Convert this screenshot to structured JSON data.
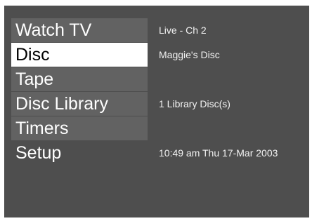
{
  "menu": {
    "items": [
      {
        "label": "Watch TV",
        "info": "Live - Ch 2"
      },
      {
        "label": "Disc",
        "info": "Maggie's Disc",
        "selected": true
      },
      {
        "label": "Tape",
        "info": ""
      },
      {
        "label": "Disc Library",
        "info": "1 Library Disc(s)"
      },
      {
        "label": "Timers",
        "info": ""
      },
      {
        "label": "Setup",
        "info": "10:49 am Thu 17-Mar 2003"
      }
    ]
  },
  "colors": {
    "screen_bg": "#4e4e4e",
    "item_bg": "#626262",
    "selected_bg": "#ffffff",
    "selected_text": "#000000",
    "text": "#ffffff"
  }
}
